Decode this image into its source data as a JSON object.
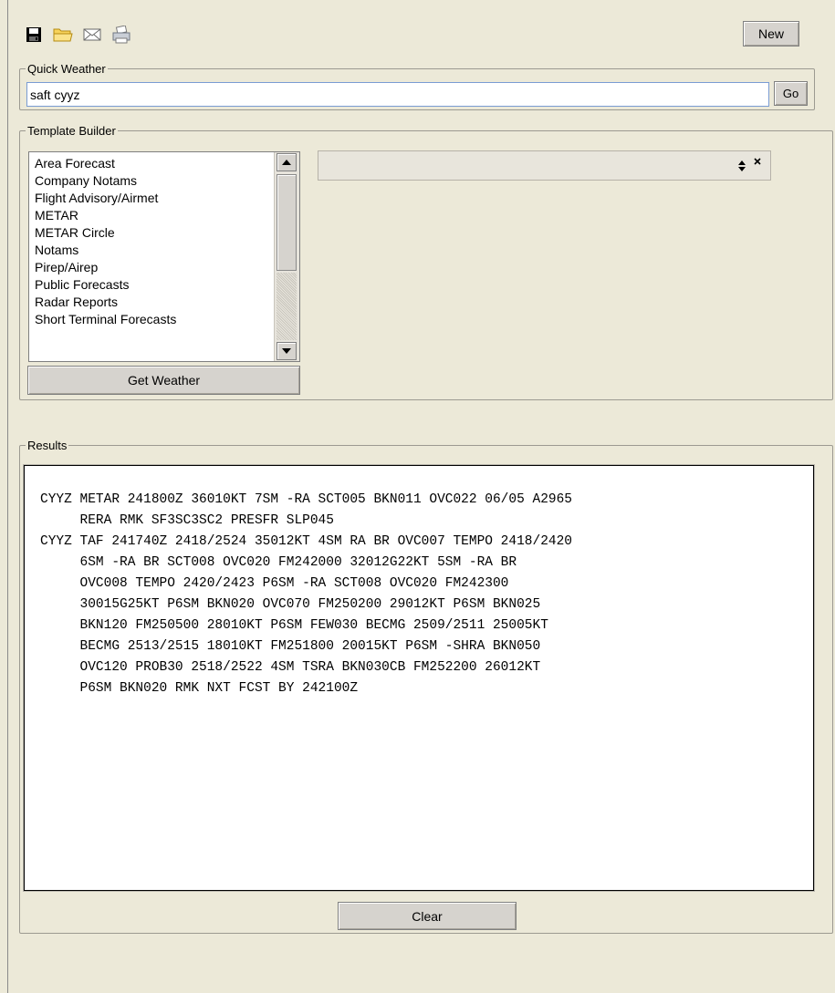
{
  "toolbar": {
    "icons": [
      "save-icon",
      "open-folder-icon",
      "email-icon",
      "print-icon"
    ],
    "new_label": "New"
  },
  "quick_weather": {
    "legend": "Quick Weather",
    "input_value": "saft cyyz",
    "go_label": "Go"
  },
  "template_builder": {
    "legend": "Template Builder",
    "items": [
      "Area Forecast",
      "Company Notams",
      "Flight Advisory/Airmet",
      "METAR",
      "METAR Circle",
      "Notams",
      "Pirep/Airep",
      "Public Forecasts",
      "Radar Reports",
      "Short Terminal Forecasts"
    ],
    "get_weather_label": "Get Weather",
    "template_value": ""
  },
  "results": {
    "legend": "Results",
    "text": "CYYZ METAR 241800Z 36010KT 7SM -RA SCT005 BKN011 OVC022 06/05 A2965\n     RERA RMK SF3SC3SC2 PRESFR SLP045\nCYYZ TAF 241740Z 2418/2524 35012KT 4SM RA BR OVC007 TEMPO 2418/2420\n     6SM -RA BR SCT008 OVC020 FM242000 32012G22KT 5SM -RA BR\n     OVC008 TEMPO 2420/2423 P6SM -RA SCT008 OVC020 FM242300\n     30015G25KT P6SM BKN020 OVC070 FM250200 29012KT P6SM BKN025\n     BKN120 FM250500 28010KT P6SM FEW030 BECMG 2509/2511 25005KT\n     BECMG 2513/2515 18010KT FM251800 20015KT P6SM -SHRA BKN050\n     OVC120 PROB30 2518/2522 4SM TSRA BKN030CB FM252200 26012KT\n     P6SM BKN020 RMK NXT FCST BY 242100Z",
    "clear_label": "Clear"
  },
  "colors": {
    "background": "#ece9d8",
    "button_face": "#d6d3ce",
    "input_border": "#7a9cd3"
  }
}
